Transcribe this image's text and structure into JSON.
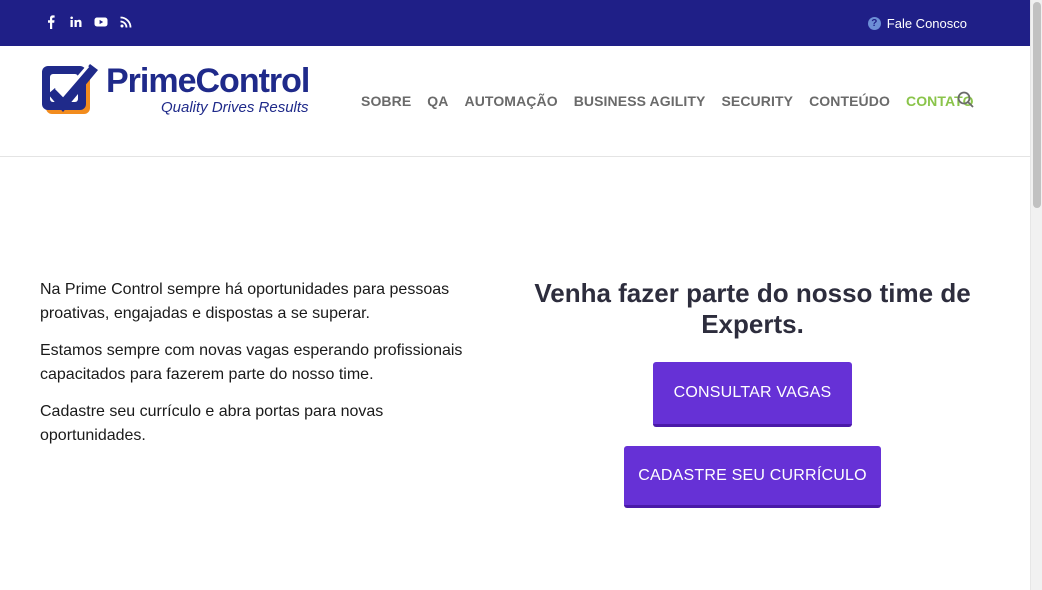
{
  "topbar": {
    "social": [
      {
        "icon": "facebook-icon"
      },
      {
        "icon": "linkedin-icon"
      },
      {
        "icon": "youtube-icon"
      },
      {
        "icon": "rss-icon"
      }
    ],
    "contact_label": "Fale Conosco",
    "contact_icon": "question-circle-icon"
  },
  "logo": {
    "name": "PrimeControl",
    "tagline": "Quality Drives Results"
  },
  "nav": {
    "items": [
      {
        "label": "SOBRE"
      },
      {
        "label": "QA"
      },
      {
        "label": "AUTOMAÇÃO"
      },
      {
        "label": "BUSINESS AGILITY"
      },
      {
        "label": "SECURITY"
      },
      {
        "label": "CONTEÚDO"
      },
      {
        "label": "CONTATO"
      }
    ],
    "search_icon": "search-icon"
  },
  "intro": {
    "paragraphs": [
      "Na Prime Control sempre há oportunidades para pessoas proativas, engajadas e dispostas a se superar.",
      "Estamos sempre com novas vagas esperando profissionais capacitados para fazerem parte do nosso time.",
      "Cadastre seu currículo e abra portas para novas oportunidades."
    ]
  },
  "cta": {
    "title": "Venha fazer parte do nosso time de Experts.",
    "button_vagas": "CONSULTAR VAGAS",
    "button_cv": "CADASTRE SEU CURRÍCULO"
  },
  "colors": {
    "topbar": "#1f1f87",
    "brand": "#1f2a8a",
    "accent_button": "#6631d6",
    "active_nav": "#8ac44a"
  }
}
